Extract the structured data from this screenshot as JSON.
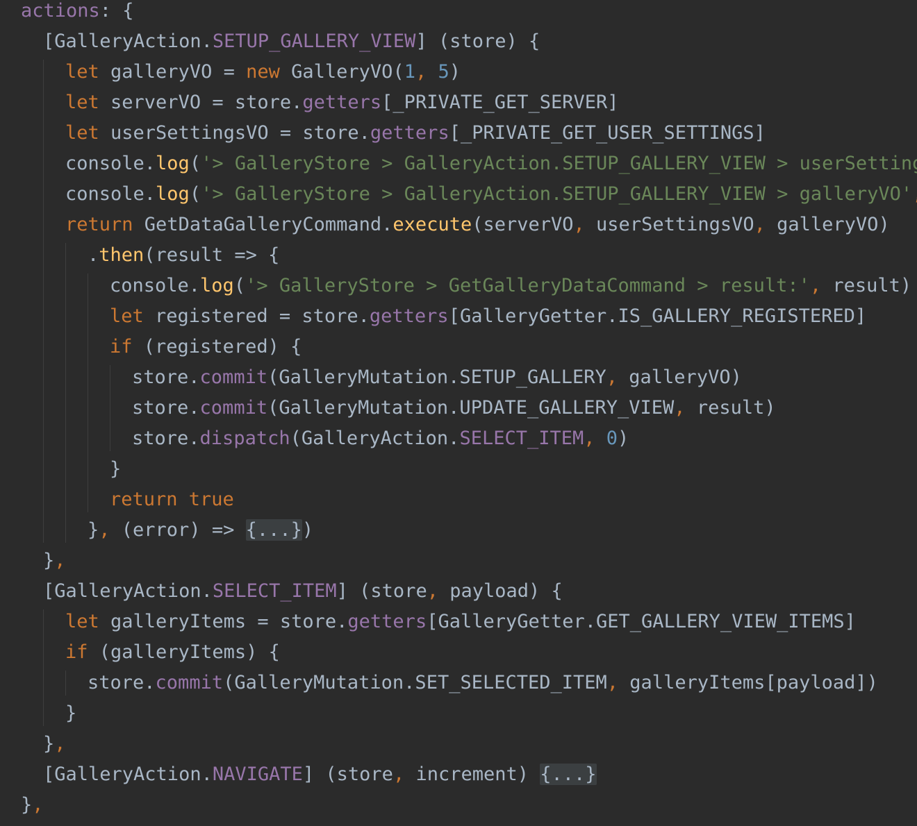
{
  "editor": {
    "colors": {
      "background": "#2b2b2b",
      "keyword": "#cc7832",
      "plain": "#a9b7c6",
      "property": "#9876aa",
      "function": "#ffc66d",
      "string": "#6a8759",
      "number": "#6897bb",
      "fold": "#3b3f41"
    },
    "lines": [
      {
        "indent": 0,
        "tokens": [
          {
            "t": "pr",
            "s": "actions"
          },
          {
            "t": "pl",
            "s": ": {"
          }
        ]
      },
      {
        "indent": 1,
        "tokens": [
          {
            "t": "pl",
            "s": "[GalleryAction."
          },
          {
            "t": "pr",
            "s": "SETUP_GALLERY_VIEW"
          },
          {
            "t": "pl",
            "s": "] (store) {"
          }
        ]
      },
      {
        "indent": 2,
        "tokens": [
          {
            "t": "kw",
            "s": "let "
          },
          {
            "t": "pl",
            "s": "galleryVO = "
          },
          {
            "t": "kw",
            "s": "new "
          },
          {
            "t": "pl",
            "s": "GalleryVO("
          },
          {
            "t": "num",
            "s": "1"
          },
          {
            "t": "kw",
            "s": ", "
          },
          {
            "t": "num",
            "s": "5"
          },
          {
            "t": "pl",
            "s": ")"
          }
        ]
      },
      {
        "indent": 2,
        "tokens": [
          {
            "t": "kw",
            "s": "let "
          },
          {
            "t": "pl",
            "s": "serverVO = store."
          },
          {
            "t": "pr",
            "s": "getters"
          },
          {
            "t": "pl",
            "s": "[_PRIVATE_GET_SERVER]"
          }
        ]
      },
      {
        "indent": 2,
        "tokens": [
          {
            "t": "kw",
            "s": "let "
          },
          {
            "t": "pl",
            "s": "userSettingsVO = store."
          },
          {
            "t": "pr",
            "s": "getters"
          },
          {
            "t": "pl",
            "s": "[_PRIVATE_GET_USER_SETTINGS]"
          }
        ]
      },
      {
        "indent": 2,
        "tokens": [
          {
            "t": "pl",
            "s": "console."
          },
          {
            "t": "fn",
            "s": "log"
          },
          {
            "t": "pl",
            "s": "("
          },
          {
            "t": "str",
            "s": "'> GalleryStore > GalleryAction.SETUP_GALLERY_VIEW > userSettings"
          }
        ]
      },
      {
        "indent": 2,
        "tokens": [
          {
            "t": "pl",
            "s": "console."
          },
          {
            "t": "fn",
            "s": "log"
          },
          {
            "t": "pl",
            "s": "("
          },
          {
            "t": "str",
            "s": "'> GalleryStore > GalleryAction.SETUP_GALLERY_VIEW > galleryVO'"
          },
          {
            "t": "kw",
            "s": ", "
          }
        ]
      },
      {
        "indent": 2,
        "tokens": [
          {
            "t": "kw",
            "s": "return "
          },
          {
            "t": "pl",
            "s": "GetDataGalleryCommand."
          },
          {
            "t": "fn",
            "s": "execute"
          },
          {
            "t": "pl",
            "s": "(serverVO"
          },
          {
            "t": "kw",
            "s": ", "
          },
          {
            "t": "pl",
            "s": "userSettingsVO"
          },
          {
            "t": "kw",
            "s": ", "
          },
          {
            "t": "pl",
            "s": "galleryVO)"
          }
        ]
      },
      {
        "indent": 3,
        "tokens": [
          {
            "t": "pl",
            "s": "."
          },
          {
            "t": "fn",
            "s": "then"
          },
          {
            "t": "pl",
            "s": "(result => {"
          }
        ]
      },
      {
        "indent": 4,
        "tokens": [
          {
            "t": "pl",
            "s": "console."
          },
          {
            "t": "fn",
            "s": "log"
          },
          {
            "t": "pl",
            "s": "("
          },
          {
            "t": "str",
            "s": "'> GalleryStore > GetGalleryDataCommand > result:'"
          },
          {
            "t": "kw",
            "s": ", "
          },
          {
            "t": "pl",
            "s": "result)"
          }
        ]
      },
      {
        "indent": 4,
        "tokens": [
          {
            "t": "kw",
            "s": "let "
          },
          {
            "t": "pl",
            "s": "registered = store."
          },
          {
            "t": "pr",
            "s": "getters"
          },
          {
            "t": "pl",
            "s": "[GalleryGetter.IS_GALLERY_REGISTERED]"
          }
        ]
      },
      {
        "indent": 4,
        "tokens": [
          {
            "t": "kw",
            "s": "if "
          },
          {
            "t": "pl",
            "s": "(registered) {"
          }
        ]
      },
      {
        "indent": 5,
        "tokens": [
          {
            "t": "pl",
            "s": "store."
          },
          {
            "t": "pr",
            "s": "commit"
          },
          {
            "t": "pl",
            "s": "(GalleryMutation.SETUP_GALLERY"
          },
          {
            "t": "kw",
            "s": ", "
          },
          {
            "t": "pl",
            "s": "galleryVO)"
          }
        ]
      },
      {
        "indent": 5,
        "tokens": [
          {
            "t": "pl",
            "s": "store."
          },
          {
            "t": "pr",
            "s": "commit"
          },
          {
            "t": "pl",
            "s": "(GalleryMutation.UPDATE_GALLERY_VIEW"
          },
          {
            "t": "kw",
            "s": ", "
          },
          {
            "t": "pl",
            "s": "result)"
          }
        ]
      },
      {
        "indent": 5,
        "tokens": [
          {
            "t": "pl",
            "s": "store."
          },
          {
            "t": "pr",
            "s": "dispatch"
          },
          {
            "t": "pl",
            "s": "(GalleryAction."
          },
          {
            "t": "pr",
            "s": "SELECT_ITEM"
          },
          {
            "t": "kw",
            "s": ", "
          },
          {
            "t": "num",
            "s": "0"
          },
          {
            "t": "pl",
            "s": ")"
          }
        ]
      },
      {
        "indent": 4,
        "tokens": [
          {
            "t": "pl",
            "s": "}"
          }
        ]
      },
      {
        "indent": 4,
        "tokens": [
          {
            "t": "kw",
            "s": "return true"
          }
        ]
      },
      {
        "indent": 3,
        "tokens": [
          {
            "t": "pl",
            "s": "}"
          },
          {
            "t": "kw",
            "s": ", "
          },
          {
            "t": "pl",
            "s": "(error) => "
          },
          {
            "t": "fold",
            "s": "{...}"
          },
          {
            "t": "pl",
            "s": ")"
          }
        ]
      },
      {
        "indent": 1,
        "tokens": [
          {
            "t": "pl",
            "s": "}"
          },
          {
            "t": "kw",
            "s": ","
          }
        ]
      },
      {
        "indent": 1,
        "tokens": [
          {
            "t": "pl",
            "s": "[GalleryAction."
          },
          {
            "t": "pr",
            "s": "SELECT_ITEM"
          },
          {
            "t": "pl",
            "s": "] (store"
          },
          {
            "t": "kw",
            "s": ", "
          },
          {
            "t": "pl",
            "s": "payload) {"
          }
        ]
      },
      {
        "indent": 2,
        "tokens": [
          {
            "t": "kw",
            "s": "let "
          },
          {
            "t": "pl",
            "s": "galleryItems = store."
          },
          {
            "t": "pr",
            "s": "getters"
          },
          {
            "t": "pl",
            "s": "[GalleryGetter.GET_GALLERY_VIEW_ITEMS]"
          }
        ]
      },
      {
        "indent": 2,
        "tokens": [
          {
            "t": "kw",
            "s": "if "
          },
          {
            "t": "pl",
            "s": "(galleryItems) {"
          }
        ]
      },
      {
        "indent": 3,
        "tokens": [
          {
            "t": "pl",
            "s": "store."
          },
          {
            "t": "pr",
            "s": "commit"
          },
          {
            "t": "pl",
            "s": "(GalleryMutation.SET_SELECTED_ITEM"
          },
          {
            "t": "kw",
            "s": ", "
          },
          {
            "t": "pl",
            "s": "galleryItems[payload])"
          }
        ]
      },
      {
        "indent": 2,
        "tokens": [
          {
            "t": "pl",
            "s": "}"
          }
        ]
      },
      {
        "indent": 1,
        "tokens": [
          {
            "t": "pl",
            "s": "}"
          },
          {
            "t": "kw",
            "s": ","
          }
        ]
      },
      {
        "indent": 1,
        "tokens": [
          {
            "t": "pl",
            "s": "[GalleryAction."
          },
          {
            "t": "pr",
            "s": "NAVIGATE"
          },
          {
            "t": "pl",
            "s": "] (store"
          },
          {
            "t": "kw",
            "s": ", "
          },
          {
            "t": "pl",
            "s": "increment) "
          },
          {
            "t": "fold",
            "s": "{...}"
          }
        ]
      },
      {
        "indent": 0,
        "tokens": [
          {
            "t": "pl",
            "s": "}"
          },
          {
            "t": "kw",
            "s": ","
          }
        ]
      }
    ]
  }
}
